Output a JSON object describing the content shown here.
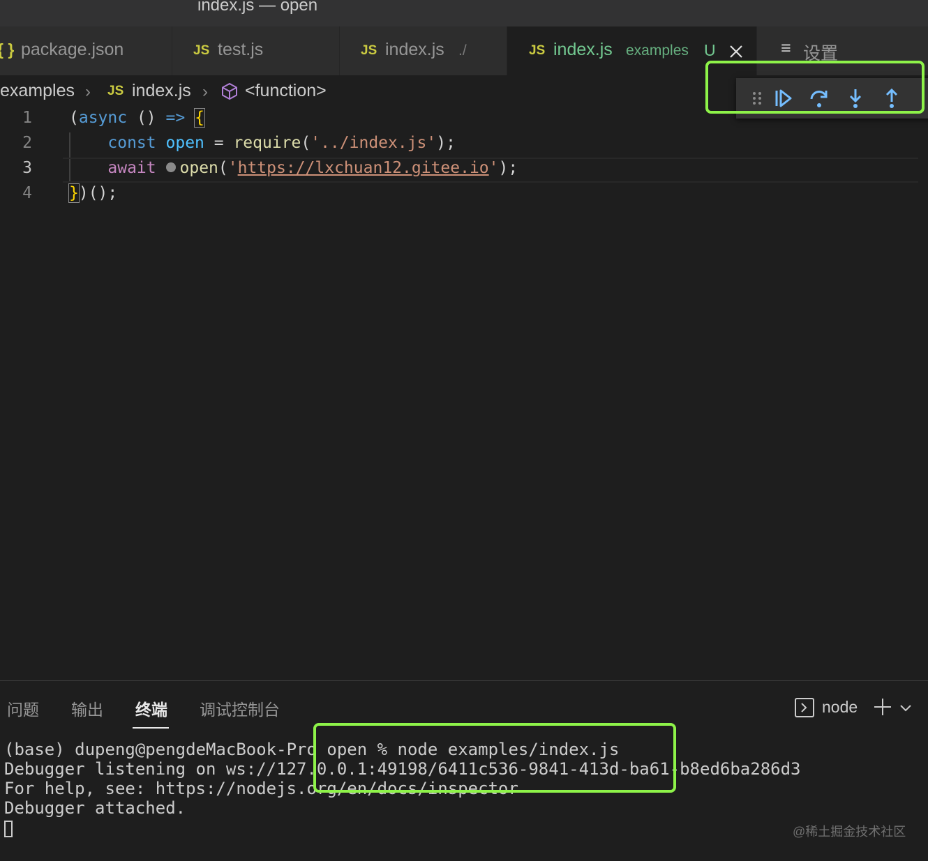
{
  "window": {
    "title": "index.js — open"
  },
  "tabs": [
    {
      "icon": "{ }",
      "label": "package.json",
      "description": ""
    },
    {
      "icon": "JS",
      "label": "test.js",
      "description": ""
    },
    {
      "icon": "JS",
      "label": "index.js",
      "description": "./"
    },
    {
      "icon": "JS",
      "label": "index.js",
      "description": "examples",
      "badge": "U",
      "active": true
    },
    {
      "icon": "≡",
      "label": "设置",
      "description": ""
    }
  ],
  "breadcrumb": {
    "folder": "examples",
    "file_icon": "JS",
    "file": "index.js",
    "symbol": "<function>"
  },
  "editor": {
    "line_numbers": [
      "1",
      "2",
      "3",
      "4"
    ],
    "current_line": 3,
    "lines": [
      {
        "t1": "(",
        "t2": "async",
        "t3": " () ",
        "t4": "=>",
        "t5": " ",
        "t6": "{"
      },
      {
        "indent": "    ",
        "t1": "const",
        "t2": " ",
        "t3": "open",
        "t4": " = ",
        "t5": "require",
        "t6": "(",
        "t7": "'../index.js'",
        "t8": ");"
      },
      {
        "indent": "    ",
        "t1": "await",
        "t2": " ",
        "t3": "open",
        "t4": "(",
        "t5": "'",
        "t6": "https://lxchuan12.gitee.io",
        "t7": "'",
        "t8": ");"
      },
      {
        "t1": "}",
        "t2": ")();"
      }
    ]
  },
  "debug_toolbar": {
    "buttons": [
      "drag-handle",
      "continue",
      "step-over",
      "step-into",
      "step-out"
    ]
  },
  "panel": {
    "tabs": [
      "问题",
      "输出",
      "终端",
      "调试控制台"
    ],
    "active_tab": "终端",
    "terminal_name": "node",
    "terminal_lines": [
      "(base) dupeng@pengdeMacBook-Pro open % node examples/index.js",
      "Debugger listening on ws://127.0.0.1:49198/6411c536-9841-413d-ba61-b8ed6ba286d3",
      "For help, see: https://nodejs.org/en/docs/inspector",
      "Debugger attached."
    ]
  },
  "watermark": "@稀土掘金技术社区",
  "colors": {
    "highlight": "#8ef349",
    "modified": "#73c991",
    "js_icon": "#cbcb41"
  }
}
